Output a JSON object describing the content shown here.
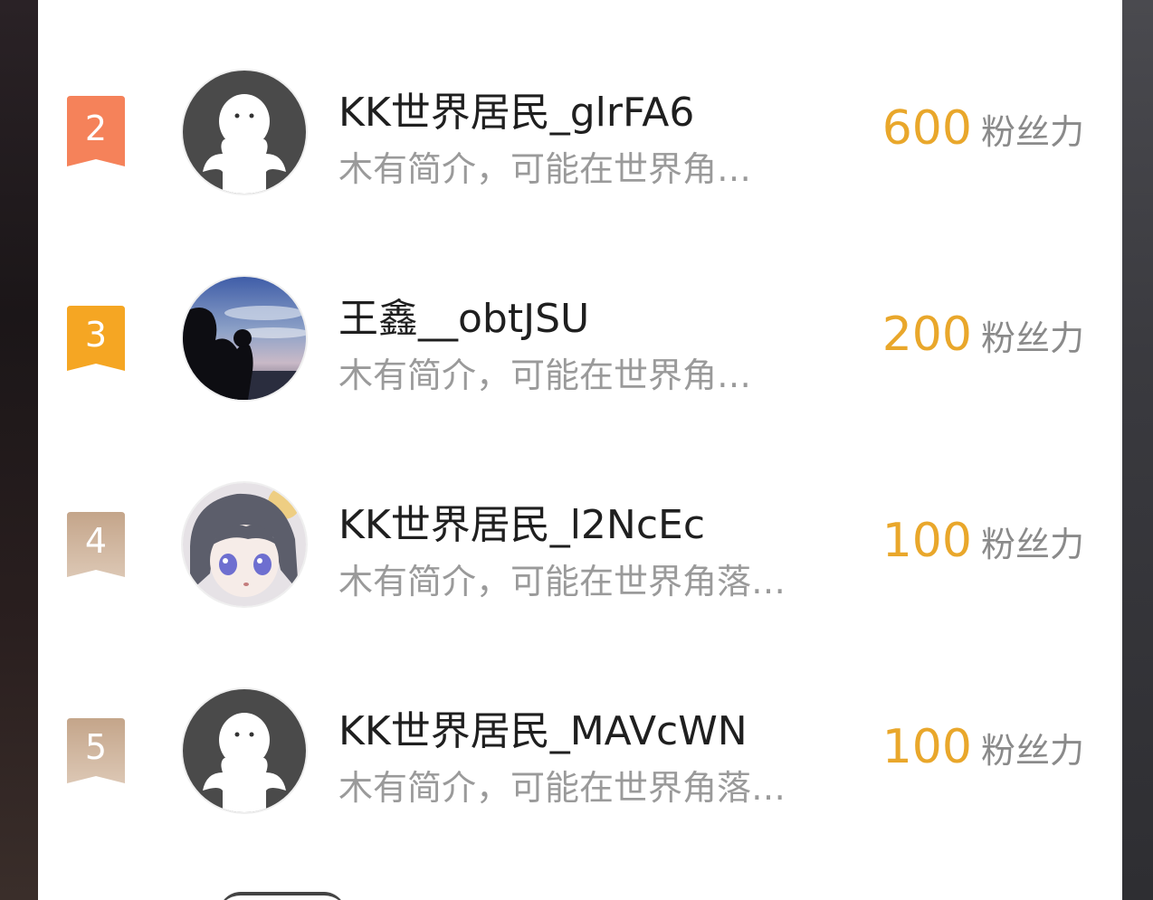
{
  "colors": {
    "rank_2": "#f5825a",
    "rank_3": "#f5a623",
    "rank_other": "#d2b8a2",
    "score": "#e9a72b",
    "name": "#1f1f1f",
    "bio": "#9a9a9a"
  },
  "rankings": [
    {
      "rank": "2",
      "name": "KK世界居民_glrFA6",
      "bio": "木有简介，可能在世界角…",
      "score": "600",
      "unit": "粉丝力",
      "avatar": "default-user-icon"
    },
    {
      "rank": "3",
      "name": "王鑫__obtJSU",
      "bio": "木有简介，可能在世界角…",
      "score": "200",
      "unit": "粉丝力",
      "avatar": "sunset-photo"
    },
    {
      "rank": "4",
      "name": "KK世界居民_l2NcEc",
      "bio": "木有简介，可能在世界角落…",
      "score": "100",
      "unit": "粉丝力",
      "avatar": "anime-character"
    },
    {
      "rank": "5",
      "name": "KK世界居民_MAVcWN",
      "bio": "木有简介，可能在世界角落…",
      "score": "100",
      "unit": "粉丝力",
      "avatar": "default-user-icon"
    }
  ]
}
